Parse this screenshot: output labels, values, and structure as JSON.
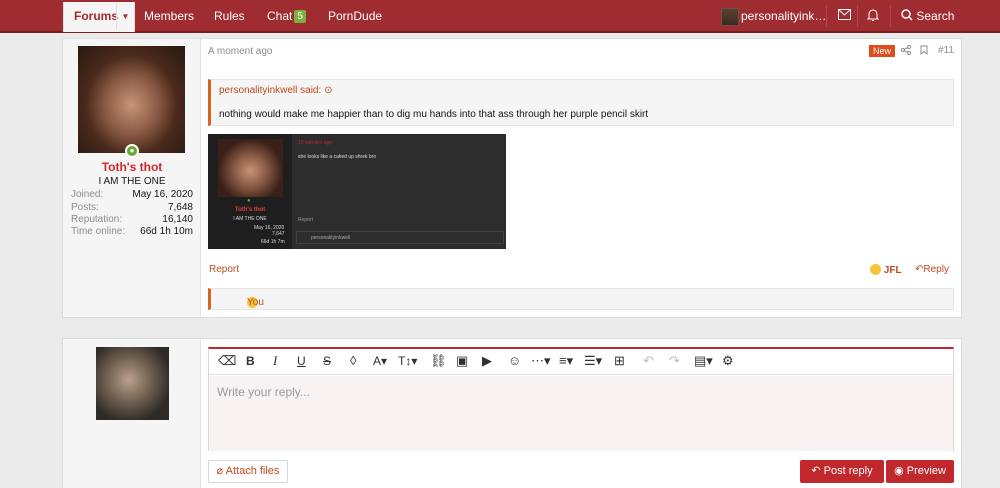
{
  "nav": {
    "tabs": [
      {
        "label": "Forums"
      },
      {
        "label": "Members"
      },
      {
        "label": "Rules"
      },
      {
        "label": "Chat",
        "badge": "5"
      },
      {
        "label": "PornDude"
      }
    ],
    "username": "personalityink…",
    "search_label": "Search"
  },
  "post": {
    "author": {
      "name": "Toth's thot",
      "title": "I AM THE ONE",
      "stats": [
        {
          "label": "Joined:",
          "value": "May 16, 2020"
        },
        {
          "label": "Posts:",
          "value": "7,648"
        },
        {
          "label": "Reputation:",
          "value": "16,140"
        },
        {
          "label": "Time online:",
          "value": "66d 1h 10m"
        }
      ]
    },
    "timestamp": "A moment ago",
    "new_label": "New",
    "post_number": "#11",
    "quote": {
      "author": "personalityinkwell said:",
      "text": "nothing would make me happier than to dig mu hands into that ass through her purple pencil skirt"
    },
    "embed": {
      "time": "10 minutes ago",
      "text": "she looks like a caked up shrek bro",
      "name": "Toth's thot",
      "title": "I AM THE ONE",
      "joined": "May 16, 2020",
      "posts": "7,647",
      "online": "66d 1h 7m",
      "report": "Report",
      "reactor": "personalityinkwell"
    },
    "report_label": "Report",
    "react_label": "JFL",
    "reply_label": "Reply",
    "reactions_text": "You"
  },
  "reply": {
    "placeholder": "Write your reply...",
    "attach_label": "Attach files",
    "post_label": "Post reply",
    "preview_label": "Preview"
  },
  "colors": {
    "nav_bg": "#9f2c30",
    "accent": "#c0282e",
    "link": "#c04a1c",
    "username": "#d3262c"
  }
}
